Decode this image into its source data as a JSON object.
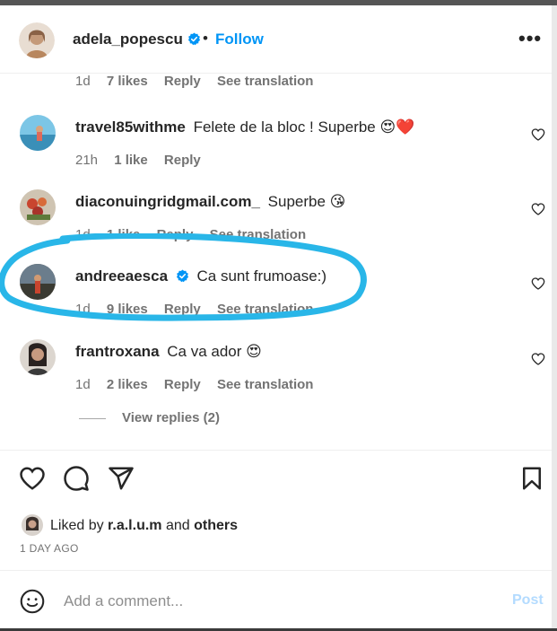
{
  "header": {
    "username": "adela_popescu",
    "separator": "•",
    "follow_label": "Follow",
    "more_label": "•••"
  },
  "top_meta": {
    "time": "1d",
    "likes": "7 likes",
    "reply": "Reply",
    "see_translation": "See translation"
  },
  "comments": [
    {
      "user": "travel85withme",
      "text": "Felete de la bloc ! Superbe",
      "emoji": "😍❤️",
      "time": "21h",
      "likes": "1 like",
      "reply": "Reply",
      "see_translation": ""
    },
    {
      "user": "diaconuingridgmail.com_",
      "text": "Superbe",
      "emoji": "😘",
      "time": "1d",
      "likes": "1 like",
      "reply": "Reply",
      "see_translation": "See translation"
    },
    {
      "user": "andreeaesca",
      "text": "Ca sunt frumoase:)",
      "emoji": "",
      "time": "1d",
      "likes": "9 likes",
      "reply": "Reply",
      "see_translation": "See translation"
    },
    {
      "user": "frantroxana",
      "text": "Ca va ador",
      "emoji": "😍",
      "time": "1d",
      "likes": "2 likes",
      "reply": "Reply",
      "see_translation": "See translation"
    }
  ],
  "view_replies": "View replies (2)",
  "likes_summary": {
    "prefix": "Liked by",
    "user": "r.a.l.u.m",
    "and": "and",
    "others": "others"
  },
  "time_ago": "1 DAY AGO",
  "composer": {
    "placeholder": "Add a comment...",
    "post_label": "Post"
  },
  "colors": {
    "accent": "#0095f6",
    "annotation": "#29b6e8",
    "verified": "#0095f6"
  }
}
